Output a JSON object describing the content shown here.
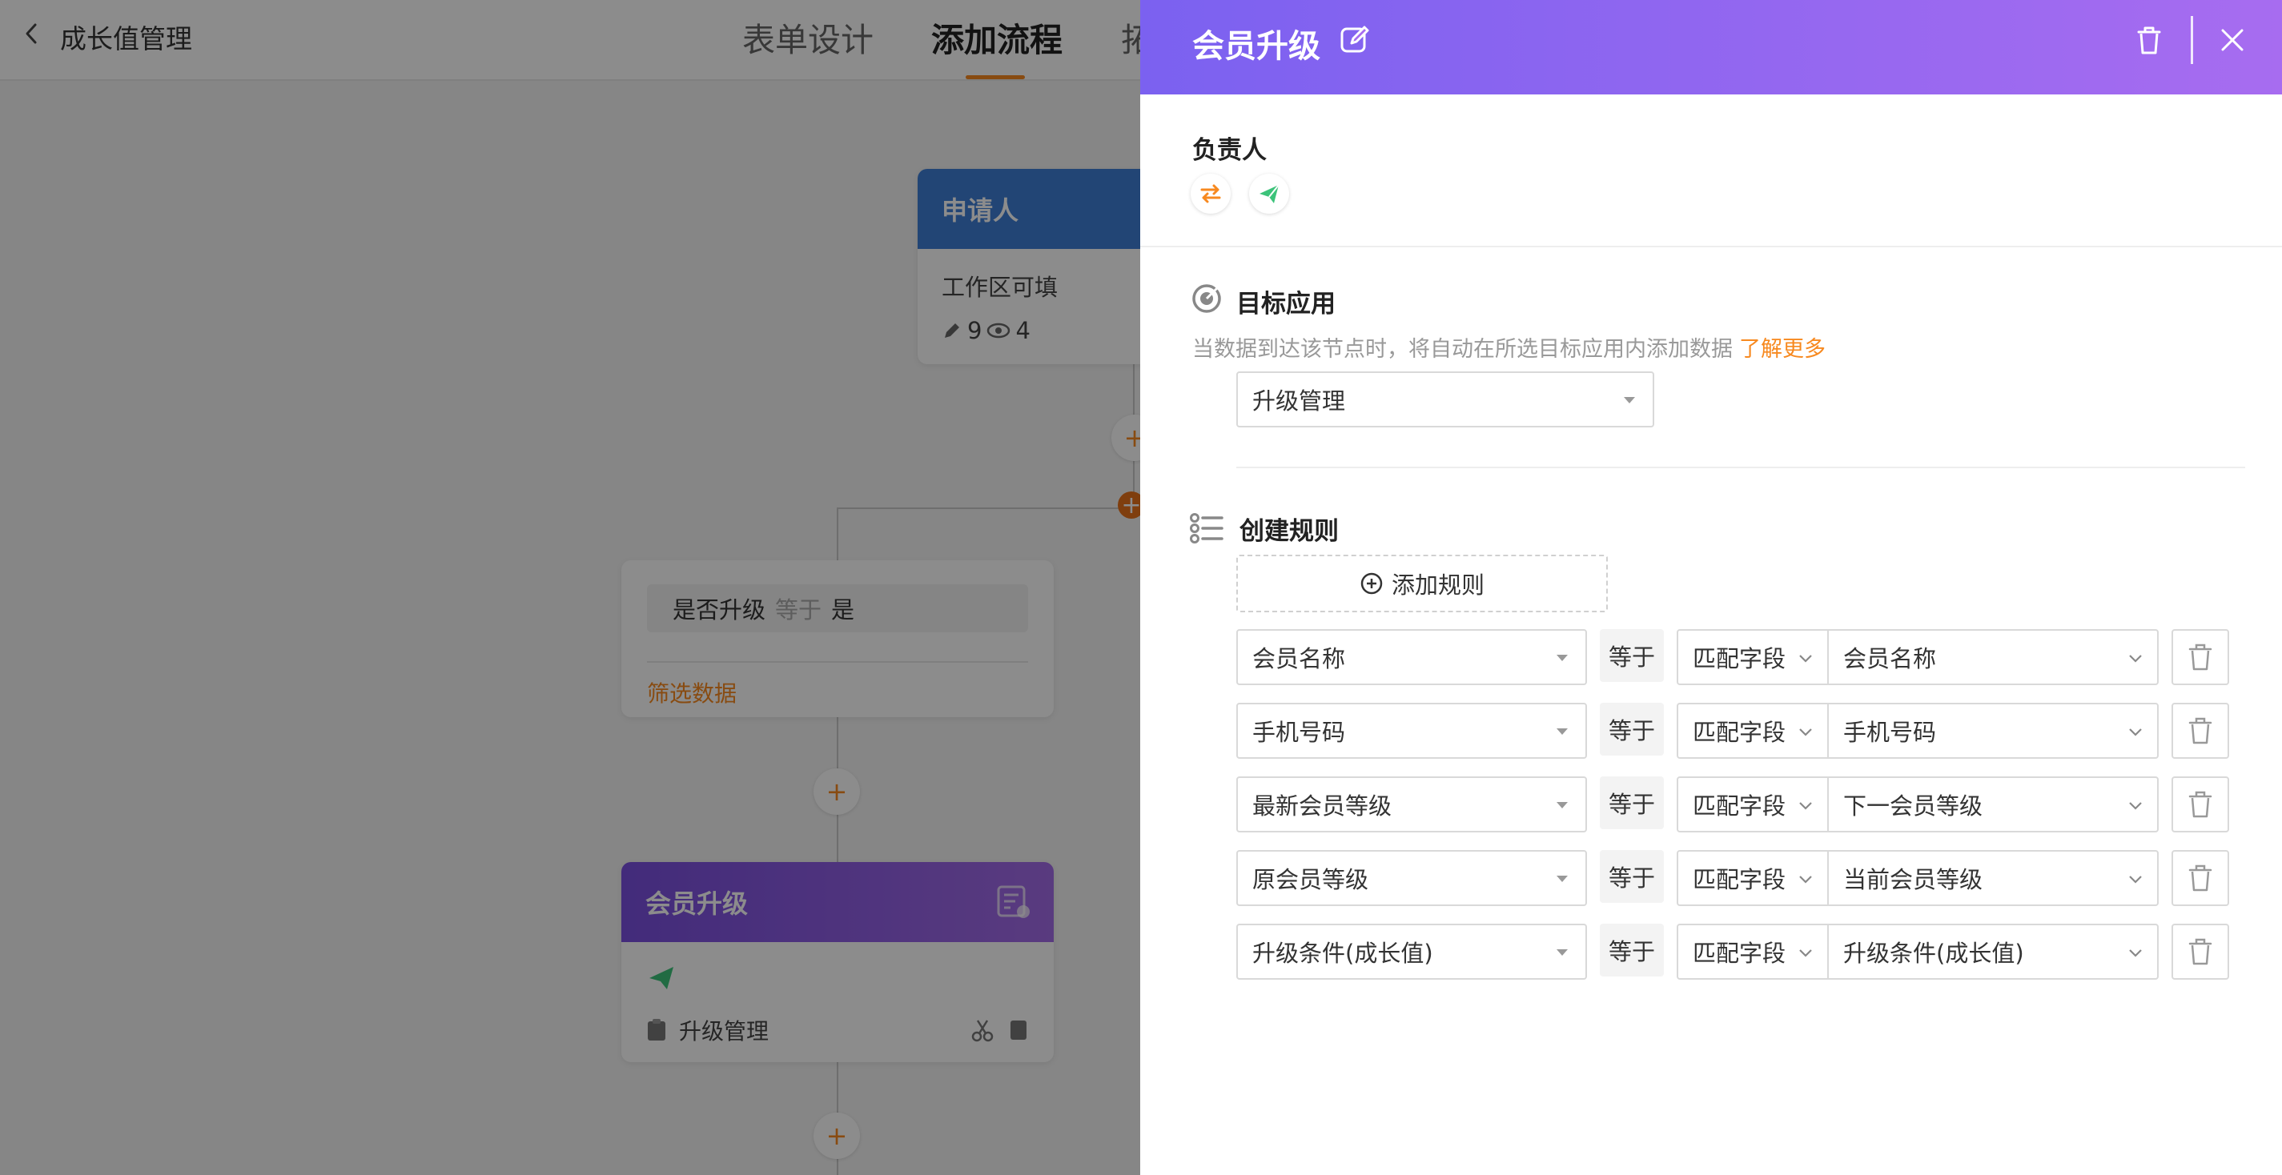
{
  "header": {
    "back_label": "back",
    "page_title": "成长值管理",
    "tabs": [
      {
        "label": "表单设计"
      },
      {
        "label": "添加流程"
      },
      {
        "label": "拓"
      }
    ]
  },
  "canvas": {
    "applicant_node": {
      "title": "申请人",
      "subtitle": "工作区可填",
      "edit_count": "9",
      "view_count": "4"
    },
    "condition_node": {
      "field": "是否升级",
      "operator": "等于",
      "value": "是",
      "filter_link": "筛选数据"
    },
    "upgrade_node": {
      "title": "会员升级",
      "target": "升级管理"
    },
    "add_symbol": "+"
  },
  "drawer": {
    "title": "会员升级",
    "owner_label": "负责人",
    "target_section": {
      "label": "目标应用",
      "description": "当数据到达该节点时，将自动在所选目标应用内添加数据",
      "learn_more": "了解更多",
      "selected_app": "升级管理"
    },
    "rules_section": {
      "label": "创建规则",
      "add_rule_label": "添加规则",
      "rules": [
        {
          "field": "会员名称",
          "operator": "等于",
          "mode": "匹配字段",
          "value": "会员名称"
        },
        {
          "field": "手机号码",
          "operator": "等于",
          "mode": "匹配字段",
          "value": "手机号码"
        },
        {
          "field": "最新会员等级",
          "operator": "等于",
          "mode": "匹配字段",
          "value": "下一会员等级"
        },
        {
          "field": "原会员等级",
          "operator": "等于",
          "mode": "匹配字段",
          "value": "当前会员等级"
        },
        {
          "field": "升级条件(成长值)",
          "operator": "等于",
          "mode": "匹配字段",
          "value": "升级条件(成长值)"
        }
      ]
    }
  },
  "colors": {
    "accent_orange": "#f7891f",
    "drawer_header_start": "#7b61f0",
    "drawer_header_end": "#a76cf0",
    "applicant_blue": "#3e7ed6",
    "send_green": "#3cc37a"
  }
}
